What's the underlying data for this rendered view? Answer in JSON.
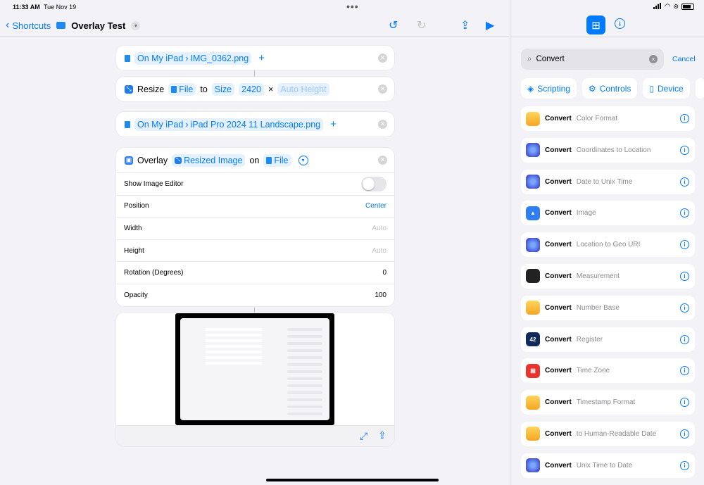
{
  "status": {
    "time": "11:33 AM",
    "date": "Tue Nov 19"
  },
  "nav": {
    "back_label": "Shortcuts",
    "title": "Overlay Test"
  },
  "actions": {
    "file1": {
      "location": "On My iPad",
      "file": "IMG_0362.png"
    },
    "resize": {
      "verb": "Resize",
      "input": "File",
      "to": "to",
      "mode": "Size",
      "width": "2420",
      "times": "×",
      "height_placeholder": "Auto Height"
    },
    "file2": {
      "location": "On My iPad",
      "file": "iPad Pro 2024 11 Landscape.png"
    },
    "overlay": {
      "verb": "Overlay",
      "image": "Resized Image",
      "on": "on",
      "target": "File",
      "params": [
        {
          "label": "Show Image Editor",
          "value": ""
        },
        {
          "label": "Position",
          "value": "Center"
        },
        {
          "label": "Width",
          "value": "Auto"
        },
        {
          "label": "Height",
          "value": "Auto"
        },
        {
          "label": "Rotation (Degrees)",
          "value": "0"
        },
        {
          "label": "Opacity",
          "value": "100"
        }
      ],
      "show_image_editor": false
    }
  },
  "sidebar": {
    "search_value": "Convert",
    "cancel_label": "Cancel",
    "categories": [
      "Scripting",
      "Controls",
      "Device"
    ],
    "items": [
      {
        "keyword": "Convert",
        "desc": "Color Format",
        "icon": "yellow"
      },
      {
        "keyword": "Convert",
        "desc": "Coordinates to Location",
        "icon": "purple"
      },
      {
        "keyword": "Convert",
        "desc": "Date to Unix Time",
        "icon": "purple"
      },
      {
        "keyword": "Convert",
        "desc": "Image",
        "icon": "blue"
      },
      {
        "keyword": "Convert",
        "desc": "Location to Geo URI",
        "icon": "purple"
      },
      {
        "keyword": "Convert",
        "desc": "Measurement",
        "icon": "dark"
      },
      {
        "keyword": "Convert",
        "desc": "Number Base",
        "icon": "yellow"
      },
      {
        "keyword": "Convert",
        "desc": "Register",
        "icon": "navy",
        "icon_text": "42"
      },
      {
        "keyword": "Convert",
        "desc": "Time Zone",
        "icon": "red"
      },
      {
        "keyword": "Convert",
        "desc": "Timestamp Format",
        "icon": "yellow"
      },
      {
        "keyword": "Convert",
        "desc": "to Human-Readable Date",
        "icon": "yellow"
      },
      {
        "keyword": "Convert",
        "desc": "Unix Time to Date",
        "icon": "purple"
      }
    ]
  },
  "colors": {
    "accent": "#007aff",
    "background": "#f2f2f7"
  }
}
